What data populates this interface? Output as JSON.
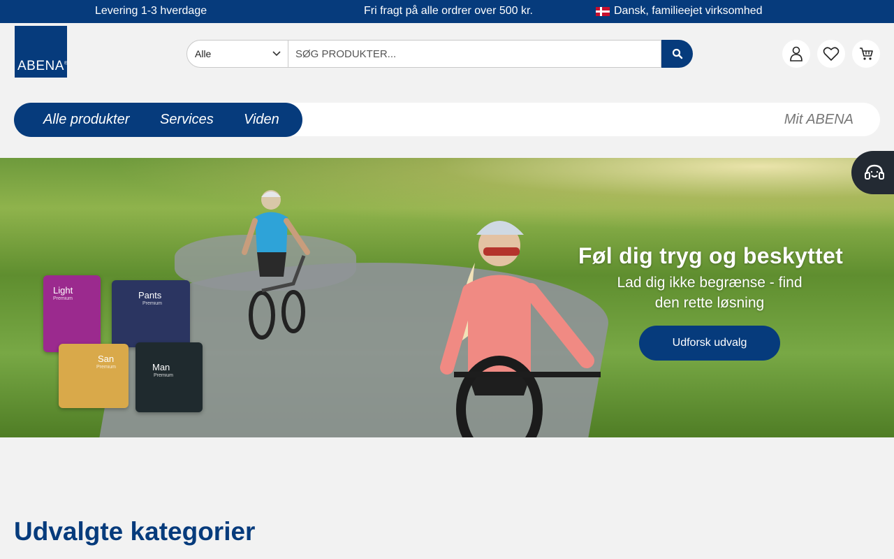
{
  "topbar": {
    "delivery": "Levering 1-3 hverdage",
    "shipping": "Fri fragt på alle ordrer over 500 kr.",
    "company": "Dansk, familieejet virksomhed"
  },
  "logo": {
    "text": "ABENA",
    "mark": "®"
  },
  "search": {
    "category": "Alle",
    "placeholder": "SØG PRODUKTER..."
  },
  "nav": {
    "items": [
      {
        "label": "Alle produkter"
      },
      {
        "label": "Services"
      },
      {
        "label": "Viden"
      }
    ],
    "mit": "Mit ABENA"
  },
  "hero": {
    "title": "Føl dig tryg og beskyttet",
    "subtitle": "Lad dig ikke begrænse - find den rette løsning",
    "cta": "Udforsk udvalg",
    "packs": [
      {
        "name": "Light",
        "sub": "Premium"
      },
      {
        "name": "Pants",
        "sub": "Premium"
      },
      {
        "name": "San",
        "sub": "Premium"
      },
      {
        "name": "Man",
        "sub": "Premium"
      }
    ]
  },
  "sections": {
    "featured_title": "Udvalgte kategorier"
  },
  "colors": {
    "brand": "#063b7c",
    "page_bg": "#f2f2f2",
    "support_bg": "#232a33"
  }
}
